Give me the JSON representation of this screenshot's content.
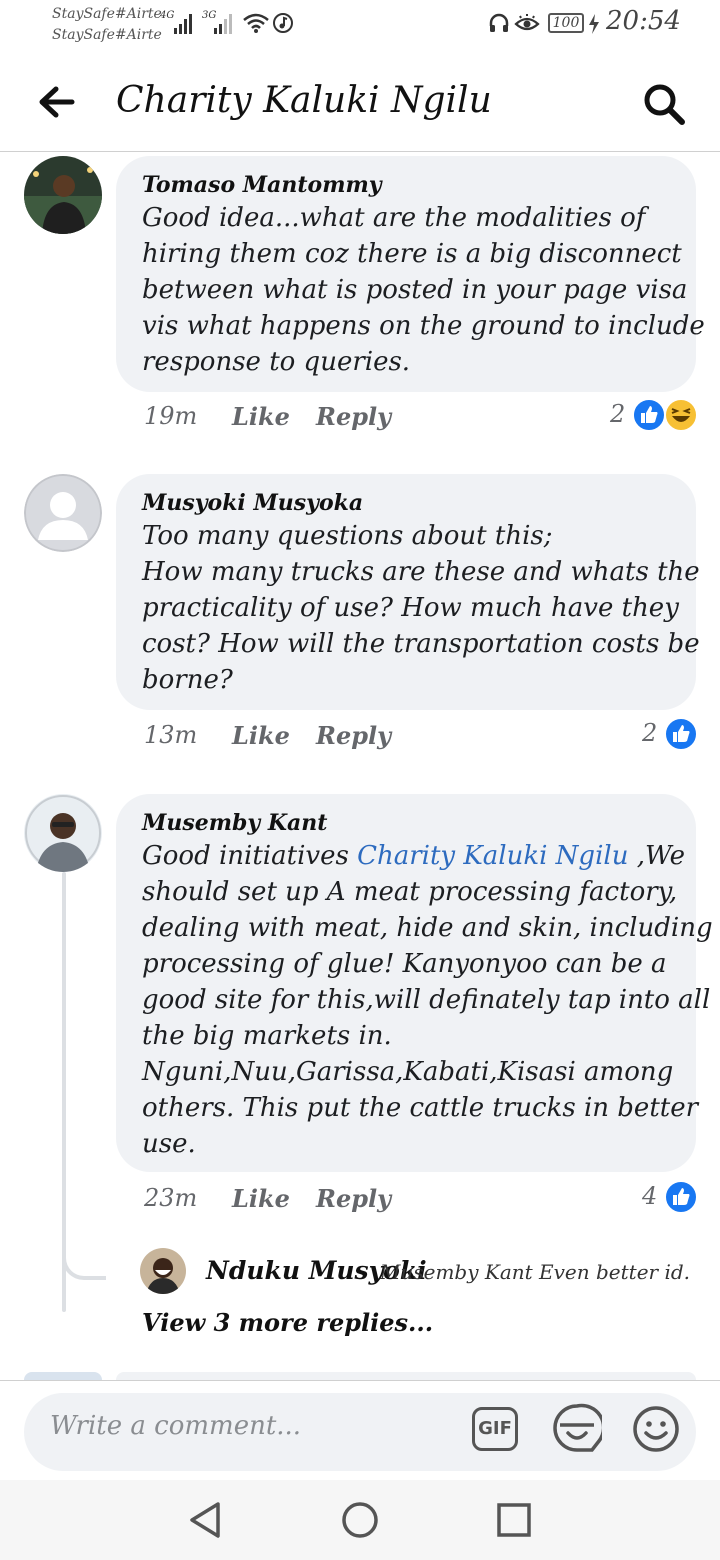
{
  "status_bar": {
    "carrier_1": "StaySafe#Airtel",
    "carrier_2": "StaySafe#Airtel",
    "network_1": "4G",
    "network_2": "3G",
    "battery": "100",
    "time": "20:54"
  },
  "header": {
    "title": "Charity Kaluki Ngilu",
    "back_icon": "arrow-left-icon",
    "search_icon": "search-icon"
  },
  "comments": [
    {
      "author": "Tomaso Mantommy",
      "lines": [
        "Good idea...what are the modalities of",
        "hiring them coz there is a big disconnect",
        "between what is posted in your page visa",
        "vis what happens on the ground to include",
        "response to queries."
      ],
      "time": "19m",
      "like": "Like",
      "reply": "Reply",
      "reaction_count": "2",
      "reactions": [
        "like-icon",
        "haha-icon"
      ]
    },
    {
      "author": "Musyoki Musyoka",
      "lines": [
        "Too many questions about this;",
        "How many trucks are these and whats the",
        "practicality of use? How much have they",
        "cost? How will the transportation costs be",
        "borne?"
      ],
      "time": "13m",
      "like": "Like",
      "reply": "Reply",
      "reaction_count": "2",
      "reactions": [
        "like-icon"
      ]
    },
    {
      "author": "Musemby Kant",
      "first_line_prefix": "Good initiatives ",
      "mention": "Charity Kaluki Ngilu",
      "first_line_suffix": " ,We",
      "lines": [
        "should set up A meat processing factory,",
        "dealing with meat, hide and skin, including",
        "processing of glue! Kanyonyoo can be a",
        "good site for this,will definately tap into all",
        "the big markets in.",
        "Nguni,Nuu,Garissa,Kabati,Kisasi among",
        "others. This put the cattle trucks in better",
        "use."
      ],
      "time": "23m",
      "like": "Like",
      "reply": "Reply",
      "reaction_count": "4",
      "reactions": [
        "like-icon"
      ],
      "reply_preview": {
        "author": "Nduku Musyoki",
        "text": "Musemby Kant Even better id..."
      },
      "view_more": "View 3 more replies..."
    }
  ],
  "composer": {
    "placeholder": "Write a comment...",
    "gif_label": "GIF",
    "sticker_icon": "sticker-icon",
    "emoji_icon": "emoji-icon"
  },
  "nav_bar": [
    "back-triangle-icon",
    "home-circle-icon",
    "recents-square-icon"
  ],
  "colors": {
    "bubble": "#f0f2f5",
    "mention": "#2d6bbf",
    "like_blue": "#1877f2",
    "meta_gray": "#65676b"
  }
}
